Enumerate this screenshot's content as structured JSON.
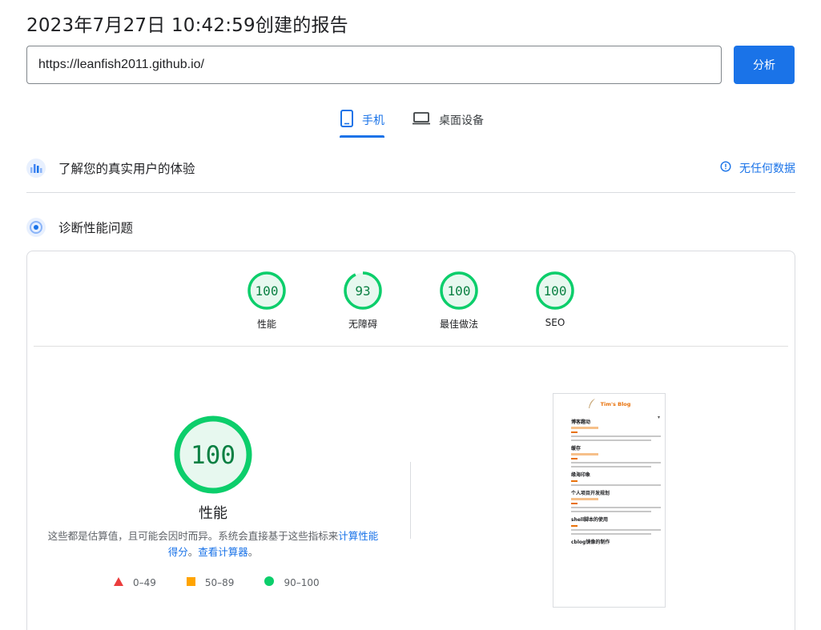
{
  "report": {
    "title": "2023年7月27日 10:42:59创建的报告"
  },
  "url_bar": {
    "value": "https://leanfish2011.github.io/",
    "placeholder": ""
  },
  "analyze_button": {
    "label": "分析"
  },
  "tabs": [
    {
      "label": "手机",
      "icon": "smartphone-icon",
      "active": true
    },
    {
      "label": "桌面设备",
      "icon": "laptop-icon",
      "active": false
    }
  ],
  "crux": {
    "title": "了解您的真实用户的体验",
    "no_data_label": "无任何数据"
  },
  "diagnostics": {
    "title": "诊断性能问题"
  },
  "categories": [
    {
      "score": "100",
      "label": "性能"
    },
    {
      "score": "93",
      "label": "无障碍"
    },
    {
      "score": "100",
      "label": "最佳做法"
    },
    {
      "score": "100",
      "label": "SEO"
    }
  ],
  "scores_numeric": [
    100,
    93,
    100,
    100
  ],
  "performance": {
    "score": "100",
    "label": "性能",
    "desc_text": "这些都是估算值，且可能会因时而异。系统会直接基于这些指标来",
    "desc_link1": "计算性能得分",
    "desc_sep": "。",
    "desc_link2": "查看计算器",
    "desc_end": "。"
  },
  "legend": [
    {
      "label": "0–49",
      "shape": "triangle",
      "color": "#eb3d3d"
    },
    {
      "label": "50–89",
      "shape": "square",
      "color": "#ffa400"
    },
    {
      "label": "90–100",
      "shape": "circle",
      "color": "#0cce6b"
    }
  ],
  "colors": {
    "accent": "#1a73e8",
    "pass": "#0cce6b",
    "pass_text": "#0b8043",
    "pass_fill": "#e7f8ef"
  },
  "screenshot": {
    "blog_name": "Tim's Blog",
    "posts": [
      "博客趣动",
      "缓存",
      "缘海印象",
      "个人项目开发规划",
      "shell脚本的使用",
      "cblog镜像的制作"
    ]
  }
}
